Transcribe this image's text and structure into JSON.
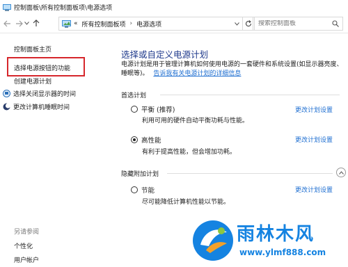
{
  "window": {
    "title": "控制面板\\所有控制面板项\\电源选项"
  },
  "navigation": {
    "back_icon": "arrow-left-icon",
    "forward_icon": "arrow-right-icon",
    "recent_icon": "chevron-down-icon",
    "up_icon": "arrow-up-icon",
    "address": {
      "overflow": "«",
      "crumbs": [
        "所有控制面板项",
        "电源选项"
      ],
      "separator": "›"
    },
    "refresh_icon": "refresh-icon",
    "search_placeholder": "搜索控制面板"
  },
  "sidebar": {
    "home": "控制面板主页",
    "links": [
      "选择电源按钮的功能",
      "创建电源计划",
      "选择关闭显示器的时间",
      "更改计算机睡眠时间"
    ],
    "see_also_title": "另请参阅",
    "see_also": [
      "个性化",
      "用户帐户"
    ]
  },
  "main": {
    "heading": "选择或自定义电源计划",
    "description": "电源计划是用于管理计算机如何使用电源的一套硬件和系统设置(如显示器亮度、睡眠等)。",
    "description_link": "告诉我有关电源计划的详细信息",
    "preferred_label": "首选计划",
    "hidden_label": "隐藏附加计划",
    "change_link": "更改计划设置",
    "plans": [
      {
        "name": "平衡 (推荐)",
        "desc": "利用可用的硬件自动平衡功耗与性能。",
        "selected": false
      },
      {
        "name": "高性能",
        "desc": "有利于提高性能，但会增加功耗。",
        "selected": true
      },
      {
        "name": "节能",
        "desc": "尽可能降低计算机性能以节能。",
        "selected": false
      }
    ]
  },
  "watermark": {
    "title": "雨林木风",
    "url": "www.ylmf888.com"
  },
  "colors": {
    "heading": "#1f3a8c",
    "link": "#1f6fd1",
    "highlight": "#d6262b",
    "watermark": "#1583e1"
  }
}
